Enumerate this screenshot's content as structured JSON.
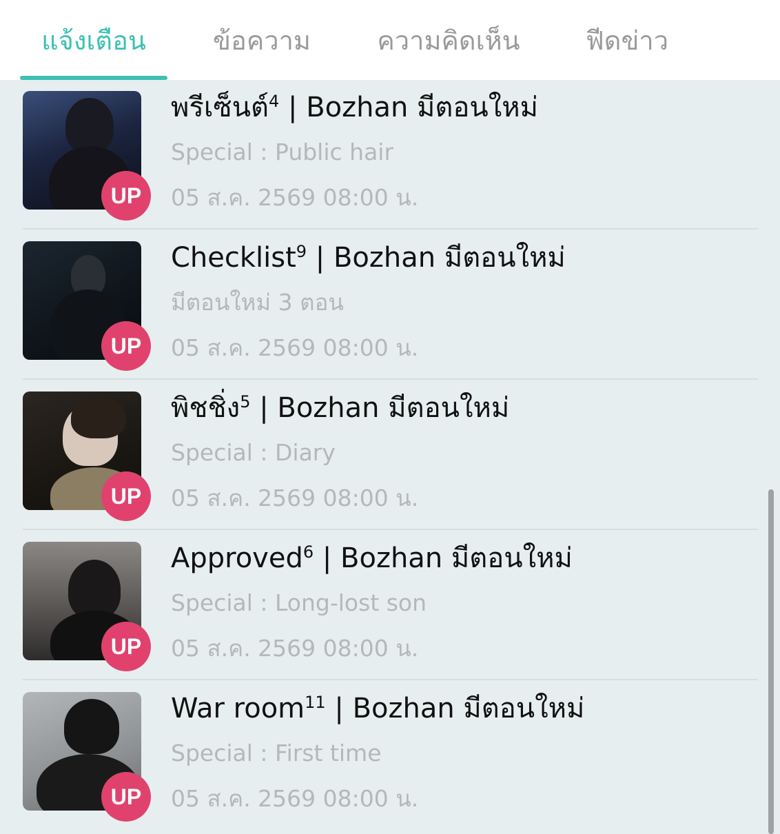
{
  "tabs": [
    {
      "label": "แจ้งเตือน",
      "active": true
    },
    {
      "label": "ข้อความ",
      "active": false
    },
    {
      "label": "ความคิดเห็น",
      "active": false
    },
    {
      "label": "ฟีดข่าว",
      "active": false
    }
  ],
  "colors": {
    "accent": "#3cc1b3",
    "badge": "#e0426d",
    "background": "#e7eeef",
    "muted_text": "#b4b8b9"
  },
  "badge_label": "UP",
  "notifications": [
    {
      "title_name": "พรีเซ็นต์",
      "title_count": "4",
      "title_suffix": " | Bozhan มีตอนใหม่",
      "subtitle": "Special : Public hair",
      "timestamp": "05 ส.ค. 2569 08:00 น."
    },
    {
      "title_name": "Checklist",
      "title_count": "9",
      "title_suffix": " | Bozhan มีตอนใหม่",
      "subtitle": "มีตอนใหม่ 3 ตอน",
      "timestamp": "05 ส.ค. 2569 08:00 น."
    },
    {
      "title_name": "พิชชิ่ง",
      "title_count": "5",
      "title_suffix": " | Bozhan มีตอนใหม่",
      "subtitle": "Special : Diary",
      "timestamp": "05 ส.ค. 2569 08:00 น."
    },
    {
      "title_name": "Approved",
      "title_count": "6",
      "title_suffix": " | Bozhan มีตอนใหม่",
      "subtitle": "Special : Long-lost son",
      "timestamp": "05 ส.ค. 2569 08:00 น."
    },
    {
      "title_name": "War room",
      "title_count": "11",
      "title_suffix": " | Bozhan มีตอนใหม่",
      "subtitle": "Special : First time",
      "timestamp": "05 ส.ค. 2569 08:00 น."
    }
  ]
}
